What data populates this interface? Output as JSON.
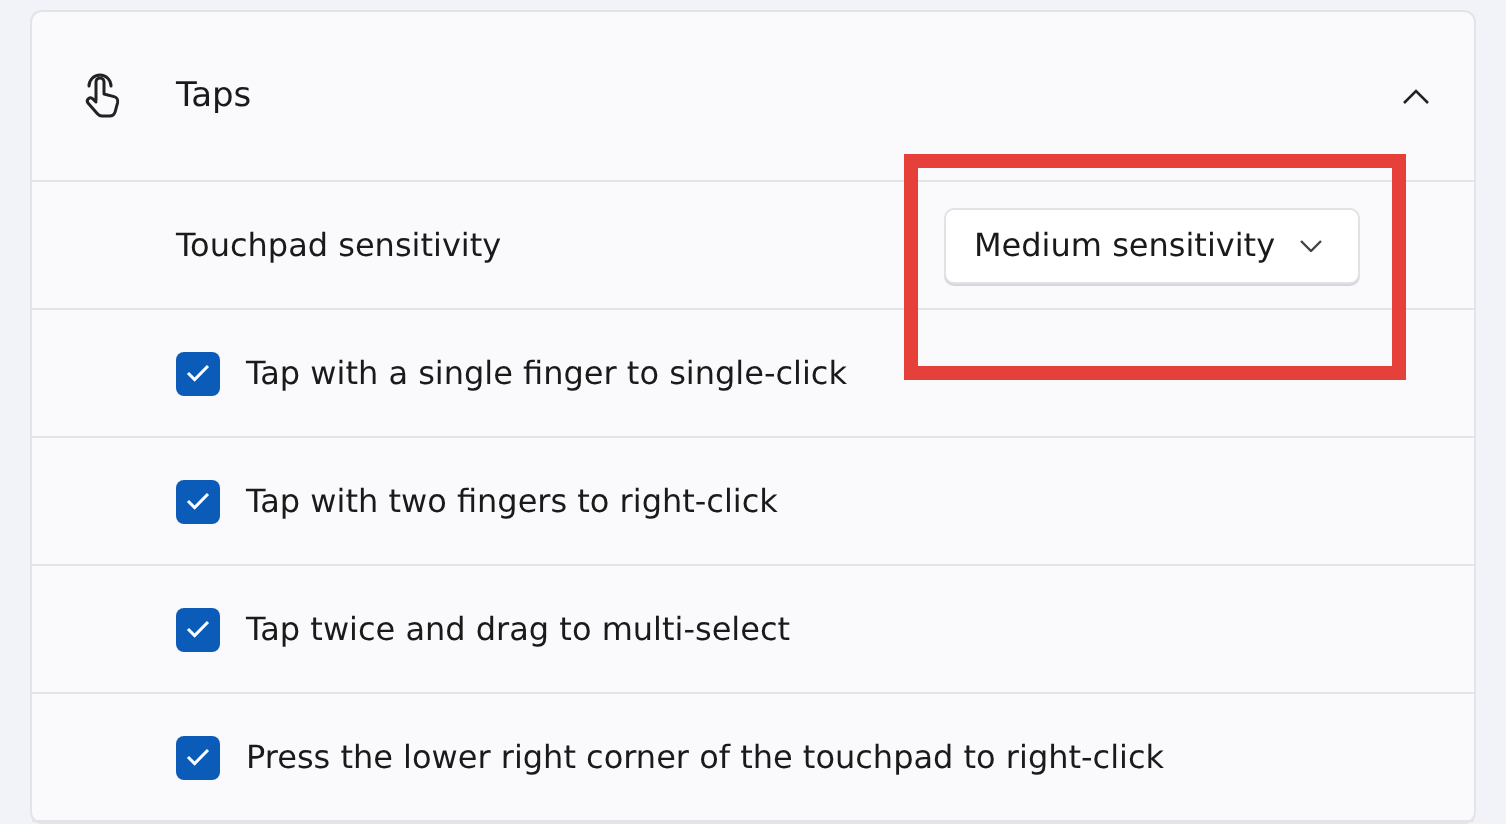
{
  "section": {
    "title": "Taps",
    "expanded": true
  },
  "sensitivity": {
    "label": "Touchpad sensitivity",
    "value": "Medium sensitivity",
    "highlighted": true
  },
  "options": [
    {
      "label": "Tap with a single finger to single-click",
      "checked": true
    },
    {
      "label": "Tap with two fingers to right-click",
      "checked": true
    },
    {
      "label": "Tap twice and drag to multi-select",
      "checked": true
    },
    {
      "label": "Press the lower right corner of the touchpad to right-click",
      "checked": true
    }
  ]
}
